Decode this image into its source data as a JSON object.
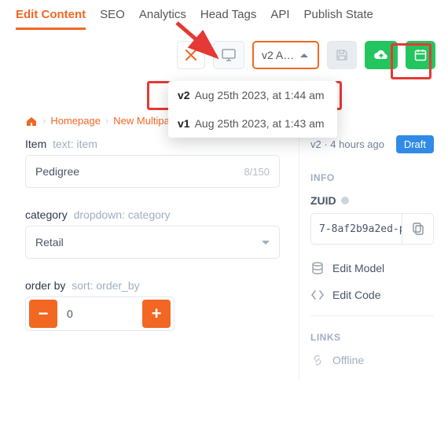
{
  "tabs": {
    "edit_content": "Edit Content",
    "seo": "SEO",
    "analytics": "Analytics",
    "head_tags": "Head Tags",
    "api": "API",
    "publish_state": "Publish State"
  },
  "toolbar": {
    "version_selected": "v2  A…"
  },
  "version_dropdown": [
    {
      "v": "v2",
      "label": "Aug 25th 2023, at 1:44 am"
    },
    {
      "v": "v1",
      "label": "Aug 25th 2023, at 1:43 am"
    }
  ],
  "breadcrumbs": {
    "home": "Homepage",
    "current": "New Multipag…"
  },
  "fields": {
    "item": {
      "label": "Item",
      "sub": "text: item",
      "value": "Pedigree",
      "counter": "8/150"
    },
    "category": {
      "label": "category",
      "sub": "dropdown: category",
      "value": "Retail"
    },
    "order_by": {
      "label": "order by",
      "sub": "sort: order_by",
      "value": "0"
    }
  },
  "right": {
    "meta_version": "v2",
    "meta_time": "4 hours ago",
    "badge": "Draft",
    "info_head": "INFO",
    "zuid_label": "ZUID",
    "zuid_value": "7-8af2b9a2ed-p",
    "edit_model": "Edit Model",
    "edit_code": "Edit Code",
    "links_head": "LINKS",
    "offline": "Offline"
  }
}
